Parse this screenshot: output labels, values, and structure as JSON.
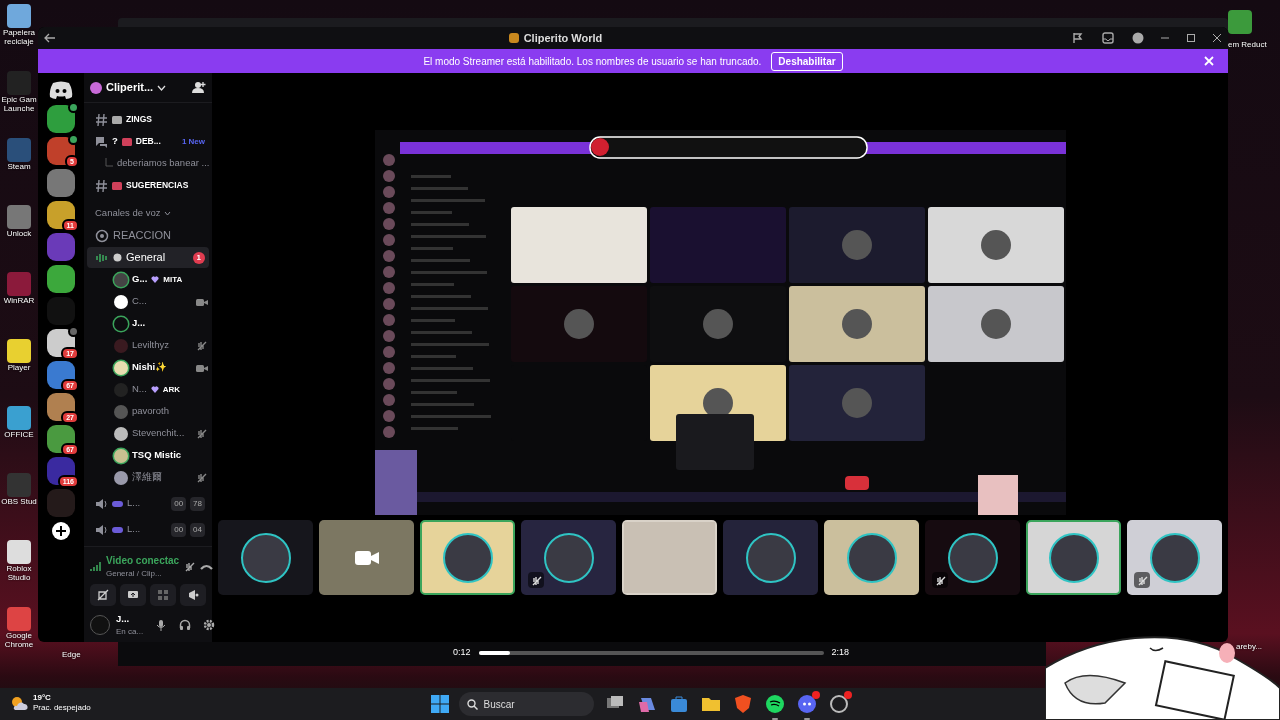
{
  "desktop": {
    "icons": [
      {
        "label": "Papelera reciclaje"
      },
      {
        "label": "Epic Gam Launche"
      },
      {
        "label": "Steam"
      },
      {
        "label": "Unlock"
      },
      {
        "label": "WinRAR"
      },
      {
        "label": "Player"
      },
      {
        "label": "OFFICE"
      },
      {
        "label": "OBS Stud"
      },
      {
        "label": "Roblox Studio"
      },
      {
        "label": "Google Chrome"
      }
    ],
    "edge_label": "Edge",
    "top_right_label": "em Reduct",
    "corner_label": "areby..."
  },
  "window": {
    "title": "Cliperito World"
  },
  "banner": {
    "text": "El modo Streamer está habilitado. Los nombres de usuario se han truncado.",
    "button": "Deshabilitar"
  },
  "servers": [
    {
      "kind": "event"
    },
    {
      "kind": "chat",
      "badge": "5"
    },
    {
      "kind": "plain"
    },
    {
      "kind": "plain",
      "badge": "11"
    },
    {
      "kind": "plain"
    },
    {
      "kind": "plain"
    },
    {
      "kind": "plain"
    },
    {
      "kind": "voice",
      "badge": "17"
    },
    {
      "kind": "plain",
      "badge": "67"
    },
    {
      "kind": "plain",
      "badge": "27"
    },
    {
      "kind": "plain",
      "badge": "67"
    },
    {
      "kind": "plain",
      "badge": "116"
    },
    {
      "kind": "plain"
    }
  ],
  "sidebar": {
    "server_name": "Cliperit...",
    "items": [
      {
        "kind": "text",
        "name": "ZINGS"
      },
      {
        "kind": "forum",
        "prefix": "?",
        "name": "DEB...",
        "badge": "1 New"
      },
      {
        "kind": "thread",
        "name": "deberiamos banear ..."
      },
      {
        "kind": "text",
        "name": "SUGERENCIAS"
      },
      {
        "kind": "category",
        "name": "Canales de voz"
      },
      {
        "kind": "stage",
        "name": "REACCION"
      },
      {
        "kind": "voice",
        "name": "General",
        "badge": "1",
        "selected": true
      },
      {
        "kind": "user",
        "name": "G...",
        "tag": "MITA",
        "speaking": true,
        "camera": false,
        "muted": false
      },
      {
        "kind": "user",
        "name": "C...",
        "speaking": false,
        "camera": true,
        "muted": false
      },
      {
        "kind": "user",
        "name": "J...",
        "speaking": true,
        "camera": false,
        "muted": false
      },
      {
        "kind": "user",
        "name": "Levilthyz",
        "speaking": false,
        "camera": false,
        "muted": true
      },
      {
        "kind": "user",
        "name": "Nishi✨",
        "speaking": true,
        "camera": true,
        "muted": false
      },
      {
        "kind": "user",
        "name": "N...",
        "tag": "ARK",
        "speaking": false,
        "camera": false,
        "muted": false
      },
      {
        "kind": "user",
        "name": "pavoroth",
        "speaking": false,
        "camera": false,
        "muted": false
      },
      {
        "kind": "user",
        "name": "Stevenchit...",
        "speaking": false,
        "camera": false,
        "muted": true
      },
      {
        "kind": "user",
        "name": "TSQ Mistic",
        "speaking": true,
        "camera": false,
        "muted": false
      },
      {
        "kind": "user",
        "name": "澤維爾",
        "speaking": false,
        "camera": false,
        "muted": true
      },
      {
        "kind": "lobby",
        "name": "L...",
        "count": "00",
        "limit": "78"
      },
      {
        "kind": "lobby",
        "name": "L...",
        "count": "00",
        "limit": "04"
      }
    ],
    "voice_panel": {
      "status": "Video conectac",
      "channel": "General / Clip..."
    },
    "user_panel": {
      "name": "J...",
      "status": "En ca..."
    }
  },
  "participants": [
    {
      "kind": "avatar",
      "color": "#16161c",
      "speaking": false,
      "muted": false
    },
    {
      "kind": "camera",
      "color": "#7c7762",
      "speaking": false,
      "muted": false
    },
    {
      "kind": "avatar",
      "color": "#e6d39a",
      "speaking": true,
      "muted": false
    },
    {
      "kind": "avatar",
      "color": "#272540",
      "speaking": false,
      "muted": true
    },
    {
      "kind": "video",
      "color": "#d9d2c8",
      "speaking": false,
      "muted": false
    },
    {
      "kind": "avatar",
      "color": "#24233a",
      "speaking": false,
      "muted": false
    },
    {
      "kind": "avatar",
      "color": "#cbbf9d",
      "speaking": false,
      "muted": false
    },
    {
      "kind": "avatar",
      "color": "#160b10",
      "speaking": false,
      "muted": true
    },
    {
      "kind": "avatar",
      "color": "#d6d6d6",
      "speaking": true,
      "muted": false
    },
    {
      "kind": "avatar",
      "color": "#cfcfd6",
      "speaking": false,
      "muted": true
    }
  ],
  "player": {
    "elapsed": "0:12",
    "duration": "2:18",
    "level": 0.09
  },
  "taskbar": {
    "weather": {
      "temp": "19°C",
      "desc": "Prac. despejado"
    },
    "search_label": "Buscar",
    "apps": [
      {
        "kind": "taskview",
        "running": false,
        "badge": false
      },
      {
        "kind": "copilot",
        "running": false,
        "badge": false
      },
      {
        "kind": "store",
        "running": false,
        "badge": false
      },
      {
        "kind": "explorer",
        "running": false,
        "badge": false
      },
      {
        "kind": "brave",
        "running": false,
        "badge": false
      },
      {
        "kind": "spotify",
        "running": true,
        "badge": false
      },
      {
        "kind": "discord",
        "running": true,
        "badge": true
      },
      {
        "kind": "other",
        "running": false,
        "badge": true
      }
    ]
  }
}
